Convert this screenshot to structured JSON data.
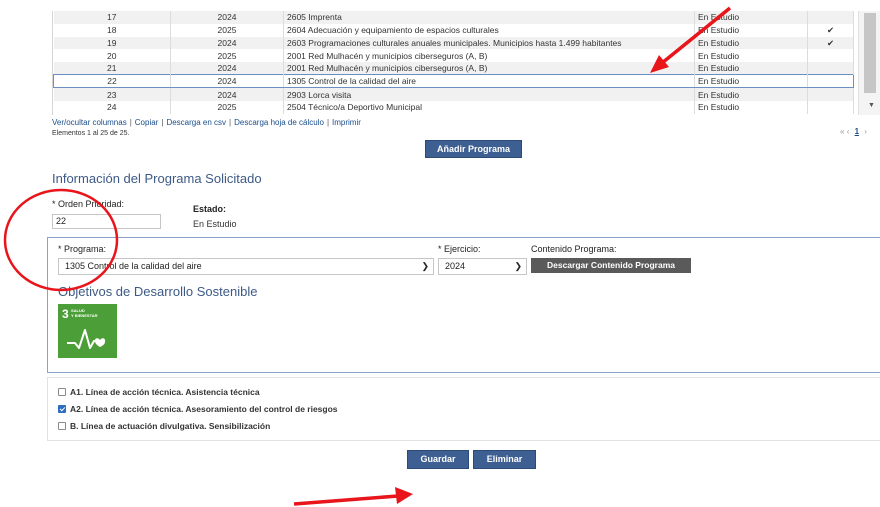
{
  "table": {
    "rows": [
      {
        "num": "17",
        "year": "2024",
        "program": "2605 Imprenta",
        "status": "En Estudio",
        "check": ""
      },
      {
        "num": "18",
        "year": "2025",
        "program": "2604 Adecuación y equipamiento de espacios culturales",
        "status": "En Estudio",
        "check": "✔"
      },
      {
        "num": "19",
        "year": "2024",
        "program": "2603 Programaciones culturales anuales municipales. Municipios hasta 1.499 habitantes",
        "status": "En Estudio",
        "check": "✔"
      },
      {
        "num": "20",
        "year": "2025",
        "program": "2001 Red Mulhacén y municipios ciberseguros (A, B)",
        "status": "En Estudio",
        "check": ""
      },
      {
        "num": "21",
        "year": "2024",
        "program": "2001 Red Mulhacén y municipios ciberseguros (A, B)",
        "status": "En Estudio",
        "check": ""
      },
      {
        "num": "22",
        "year": "2024",
        "program": "1305 Control de la calidad del aire",
        "status": "En Estudio",
        "check": ""
      },
      {
        "num": "23",
        "year": "2024",
        "program": "2903 Lorca visita",
        "status": "En Estudio",
        "check": ""
      },
      {
        "num": "24",
        "year": "2025",
        "program": "2504 Técnico/a Deportivo Municipal",
        "status": "En Estudio",
        "check": ""
      }
    ],
    "links": [
      "Ver/ocultar columnas",
      "Copiar",
      "Descarga en csv",
      "Descarga hoja de cálculo",
      "Imprimir"
    ],
    "count_text": "Elementos 1 al 25 de 25.",
    "pager": {
      "first": "«",
      "prev": "‹",
      "current": "1",
      "next": "›"
    }
  },
  "add_button": "Añadir Programa",
  "section_title": "Información del Programa Solicitado",
  "form": {
    "orden_label": "* Orden Prioridad:",
    "orden_value": "22",
    "estado_label": "Estado:",
    "estado_value": "En Estudio",
    "programa_label": "* Programa:",
    "programa_value": "1305 Control de la calidad del aire",
    "ejercicio_label": "* Ejercicio:",
    "ejercicio_value": "2024",
    "contenido_label": "Contenido Programa:",
    "descargar_button": "Descargar Contenido Programa"
  },
  "ods": {
    "title": "Objetivos de Desarrollo Sostenible",
    "tile_number": "3",
    "tile_text_1": "SALUD",
    "tile_text_2": "Y BIENESTAR",
    "tile_color": "#4c9f38"
  },
  "options": [
    {
      "label": "A1. Línea de acción técnica. Asistencia técnica",
      "checked": false
    },
    {
      "label": "A2. Línea de acción técnica. Asesoramiento del control de riesgos",
      "checked": true
    },
    {
      "label": "B. Línea de actuación divulgativa. Sensibilización",
      "checked": false
    }
  ],
  "actions": {
    "save": "Guardar",
    "delete": "Eliminar"
  },
  "colors": {
    "primary_button": "#3d5f91",
    "annotation_red": "#e8151b",
    "link": "#1a4e8c"
  }
}
